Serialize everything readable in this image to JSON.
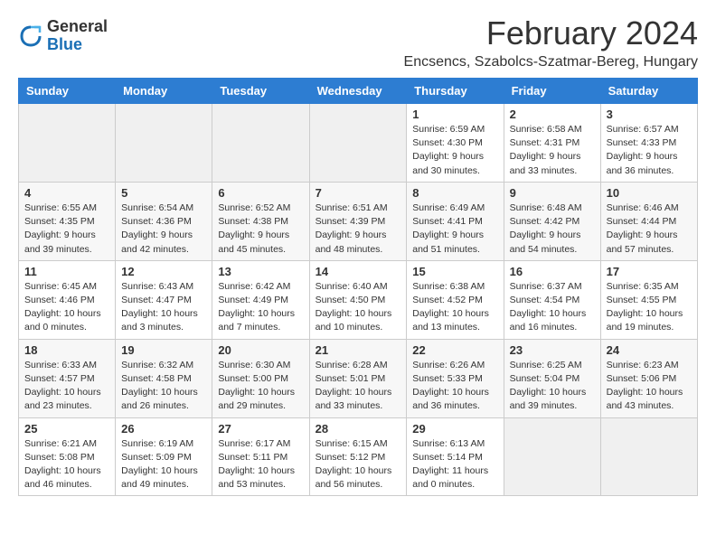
{
  "logo": {
    "general": "General",
    "blue": "Blue"
  },
  "title": {
    "month_year": "February 2024",
    "location": "Encsencs, Szabolcs-Szatmar-Bereg, Hungary"
  },
  "header_days": [
    "Sunday",
    "Monday",
    "Tuesday",
    "Wednesday",
    "Thursday",
    "Friday",
    "Saturday"
  ],
  "weeks": [
    [
      {
        "day": "",
        "info": ""
      },
      {
        "day": "",
        "info": ""
      },
      {
        "day": "",
        "info": ""
      },
      {
        "day": "",
        "info": ""
      },
      {
        "day": "1",
        "info": "Sunrise: 6:59 AM\nSunset: 4:30 PM\nDaylight: 9 hours\nand 30 minutes."
      },
      {
        "day": "2",
        "info": "Sunrise: 6:58 AM\nSunset: 4:31 PM\nDaylight: 9 hours\nand 33 minutes."
      },
      {
        "day": "3",
        "info": "Sunrise: 6:57 AM\nSunset: 4:33 PM\nDaylight: 9 hours\nand 36 minutes."
      }
    ],
    [
      {
        "day": "4",
        "info": "Sunrise: 6:55 AM\nSunset: 4:35 PM\nDaylight: 9 hours\nand 39 minutes."
      },
      {
        "day": "5",
        "info": "Sunrise: 6:54 AM\nSunset: 4:36 PM\nDaylight: 9 hours\nand 42 minutes."
      },
      {
        "day": "6",
        "info": "Sunrise: 6:52 AM\nSunset: 4:38 PM\nDaylight: 9 hours\nand 45 minutes."
      },
      {
        "day": "7",
        "info": "Sunrise: 6:51 AM\nSunset: 4:39 PM\nDaylight: 9 hours\nand 48 minutes."
      },
      {
        "day": "8",
        "info": "Sunrise: 6:49 AM\nSunset: 4:41 PM\nDaylight: 9 hours\nand 51 minutes."
      },
      {
        "day": "9",
        "info": "Sunrise: 6:48 AM\nSunset: 4:42 PM\nDaylight: 9 hours\nand 54 minutes."
      },
      {
        "day": "10",
        "info": "Sunrise: 6:46 AM\nSunset: 4:44 PM\nDaylight: 9 hours\nand 57 minutes."
      }
    ],
    [
      {
        "day": "11",
        "info": "Sunrise: 6:45 AM\nSunset: 4:46 PM\nDaylight: 10 hours\nand 0 minutes."
      },
      {
        "day": "12",
        "info": "Sunrise: 6:43 AM\nSunset: 4:47 PM\nDaylight: 10 hours\nand 3 minutes."
      },
      {
        "day": "13",
        "info": "Sunrise: 6:42 AM\nSunset: 4:49 PM\nDaylight: 10 hours\nand 7 minutes."
      },
      {
        "day": "14",
        "info": "Sunrise: 6:40 AM\nSunset: 4:50 PM\nDaylight: 10 hours\nand 10 minutes."
      },
      {
        "day": "15",
        "info": "Sunrise: 6:38 AM\nSunset: 4:52 PM\nDaylight: 10 hours\nand 13 minutes."
      },
      {
        "day": "16",
        "info": "Sunrise: 6:37 AM\nSunset: 4:54 PM\nDaylight: 10 hours\nand 16 minutes."
      },
      {
        "day": "17",
        "info": "Sunrise: 6:35 AM\nSunset: 4:55 PM\nDaylight: 10 hours\nand 19 minutes."
      }
    ],
    [
      {
        "day": "18",
        "info": "Sunrise: 6:33 AM\nSunset: 4:57 PM\nDaylight: 10 hours\nand 23 minutes."
      },
      {
        "day": "19",
        "info": "Sunrise: 6:32 AM\nSunset: 4:58 PM\nDaylight: 10 hours\nand 26 minutes."
      },
      {
        "day": "20",
        "info": "Sunrise: 6:30 AM\nSunset: 5:00 PM\nDaylight: 10 hours\nand 29 minutes."
      },
      {
        "day": "21",
        "info": "Sunrise: 6:28 AM\nSunset: 5:01 PM\nDaylight: 10 hours\nand 33 minutes."
      },
      {
        "day": "22",
        "info": "Sunrise: 6:26 AM\nSunset: 5:33 PM\nDaylight: 10 hours\nand 36 minutes."
      },
      {
        "day": "23",
        "info": "Sunrise: 6:25 AM\nSunset: 5:04 PM\nDaylight: 10 hours\nand 39 minutes."
      },
      {
        "day": "24",
        "info": "Sunrise: 6:23 AM\nSunset: 5:06 PM\nDaylight: 10 hours\nand 43 minutes."
      }
    ],
    [
      {
        "day": "25",
        "info": "Sunrise: 6:21 AM\nSunset: 5:08 PM\nDaylight: 10 hours\nand 46 minutes."
      },
      {
        "day": "26",
        "info": "Sunrise: 6:19 AM\nSunset: 5:09 PM\nDaylight: 10 hours\nand 49 minutes."
      },
      {
        "day": "27",
        "info": "Sunrise: 6:17 AM\nSunset: 5:11 PM\nDaylight: 10 hours\nand 53 minutes."
      },
      {
        "day": "28",
        "info": "Sunrise: 6:15 AM\nSunset: 5:12 PM\nDaylight: 10 hours\nand 56 minutes."
      },
      {
        "day": "29",
        "info": "Sunrise: 6:13 AM\nSunset: 5:14 PM\nDaylight: 11 hours\nand 0 minutes."
      },
      {
        "day": "",
        "info": ""
      },
      {
        "day": "",
        "info": ""
      }
    ]
  ]
}
